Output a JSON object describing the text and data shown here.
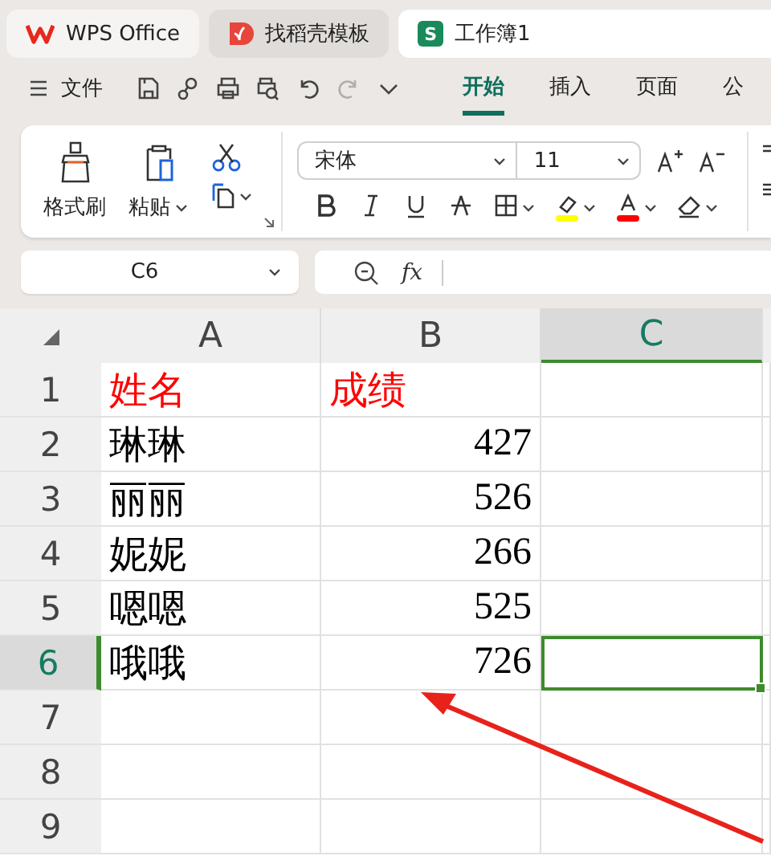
{
  "tabs": [
    {
      "label": "WPS Office",
      "kind": "wps",
      "selected": false
    },
    {
      "label": "找稻壳模板",
      "kind": "template",
      "selected": false
    },
    {
      "label": "工作簿1",
      "kind": "sheet",
      "badge": "S",
      "selected": true
    }
  ],
  "menu": {
    "label": "文件"
  },
  "quick_actions": [
    {
      "kind": "save",
      "disabled": false
    },
    {
      "kind": "share",
      "disabled": false
    },
    {
      "kind": "print",
      "disabled": false
    },
    {
      "kind": "preview",
      "disabled": false
    },
    {
      "kind": "undo",
      "disabled": false
    },
    {
      "kind": "redo",
      "disabled": true
    },
    {
      "kind": "more",
      "disabled": false
    }
  ],
  "ribbon_tabs": [
    {
      "label": "开始",
      "selected": true
    },
    {
      "label": "插入",
      "selected": false
    },
    {
      "label": "页面",
      "selected": false
    },
    {
      "label": "公",
      "selected": false
    }
  ],
  "clipboard": [
    {
      "label": "格式刷",
      "kind": "painter"
    },
    {
      "label": "粘贴",
      "kind": "paste"
    }
  ],
  "font": {
    "name": "宋体",
    "size": "11"
  },
  "format_buttons": [
    {
      "kind": "bold"
    },
    {
      "kind": "italic"
    },
    {
      "kind": "underline"
    },
    {
      "kind": "strike"
    },
    {
      "kind": "border"
    },
    {
      "kind": "highlight",
      "color": "#ffff00"
    },
    {
      "kind": "fontcolor",
      "color": "#ff0000"
    },
    {
      "kind": "eraser"
    }
  ],
  "name_box": "C6",
  "function_label": "fx",
  "columns": [
    {
      "label": "A",
      "selected": false
    },
    {
      "label": "B",
      "selected": false
    },
    {
      "label": "C",
      "selected": true
    }
  ],
  "rows": [
    {
      "label": "1",
      "kind": "header",
      "selected": false,
      "cells": [
        {
          "text": "姓名",
          "kind": "text"
        },
        {
          "text": "成绩",
          "kind": "text"
        }
      ]
    },
    {
      "label": "2",
      "kind": "data",
      "selected": false,
      "cells": [
        {
          "text": "琳琳",
          "kind": "text"
        },
        {
          "text": "427",
          "kind": "number"
        }
      ]
    },
    {
      "label": "3",
      "kind": "data",
      "selected": false,
      "cells": [
        {
          "text": "丽丽",
          "kind": "text"
        },
        {
          "text": "526",
          "kind": "number"
        }
      ]
    },
    {
      "label": "4",
      "kind": "data",
      "selected": false,
      "cells": [
        {
          "text": "妮妮",
          "kind": "text"
        },
        {
          "text": "266",
          "kind": "number"
        }
      ]
    },
    {
      "label": "5",
      "kind": "data",
      "selected": false,
      "cells": [
        {
          "text": "嗯嗯",
          "kind": "text"
        },
        {
          "text": "525",
          "kind": "number"
        }
      ]
    },
    {
      "label": "6",
      "kind": "data",
      "selected": true,
      "cells": [
        {
          "text": "哦哦",
          "kind": "text"
        },
        {
          "text": "726",
          "kind": "number"
        }
      ]
    },
    {
      "label": "7",
      "kind": "data",
      "selected": false
    },
    {
      "label": "8",
      "kind": "data",
      "selected": false
    },
    {
      "label": "9",
      "kind": "data",
      "selected": false
    }
  ],
  "annotations": [
    {
      "kind": "arrow",
      "color": "#e8221b"
    }
  ]
}
